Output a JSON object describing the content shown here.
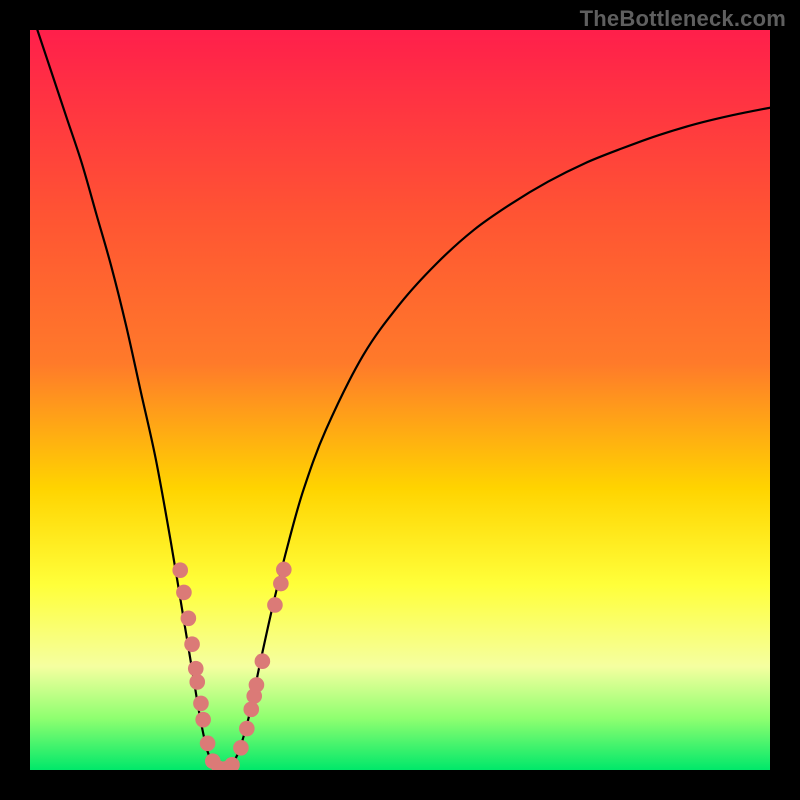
{
  "watermark": "TheBottleneck.com",
  "colors": {
    "gradient_top": "#ff1f4b",
    "gradient_mid1": "#ff7a2a",
    "gradient_mid2": "#ffd400",
    "gradient_yellow": "#ffff3a",
    "gradient_pale": "#f5ffa0",
    "gradient_green1": "#8fff70",
    "gradient_green2": "#00e86a",
    "curve": "#000000",
    "marker_fill": "#db7a77",
    "marker_stroke": "#b85a58"
  },
  "chart_data": {
    "type": "line",
    "title": "",
    "xlabel": "",
    "ylabel": "",
    "xlim": [
      0,
      100
    ],
    "ylim": [
      0,
      100
    ],
    "optimum_x": 26,
    "series": [
      {
        "name": "bottleneck-curve",
        "x": [
          1,
          3,
          5,
          7,
          9,
          11,
          13,
          15,
          17,
          19,
          21,
          22,
          23,
          24,
          25,
          26,
          27,
          28,
          29,
          30,
          31,
          33,
          35,
          37,
          40,
          45,
          50,
          55,
          60,
          65,
          70,
          75,
          80,
          85,
          90,
          95,
          100
        ],
        "y": [
          100,
          94,
          88,
          82,
          75,
          68,
          60,
          51,
          42,
          31,
          19,
          13,
          7,
          2.5,
          0.5,
          0,
          0.5,
          2,
          5,
          9,
          14,
          23,
          31,
          38,
          46,
          56,
          63,
          68.5,
          73,
          76.5,
          79.5,
          82,
          84,
          85.8,
          87.3,
          88.5,
          89.5
        ]
      }
    ],
    "markers": {
      "name": "sample-points",
      "points": [
        {
          "x": 20.3,
          "y": 27
        },
        {
          "x": 20.8,
          "y": 24
        },
        {
          "x": 21.4,
          "y": 20.5
        },
        {
          "x": 21.9,
          "y": 17
        },
        {
          "x": 22.4,
          "y": 13.7
        },
        {
          "x": 22.6,
          "y": 11.9
        },
        {
          "x": 23.1,
          "y": 9
        },
        {
          "x": 23.4,
          "y": 6.8
        },
        {
          "x": 24.0,
          "y": 3.6
        },
        {
          "x": 24.7,
          "y": 1.2
        },
        {
          "x": 25.6,
          "y": 0.2
        },
        {
          "x": 26.4,
          "y": 0.15
        },
        {
          "x": 27.3,
          "y": 0.7
        },
        {
          "x": 28.5,
          "y": 3.0
        },
        {
          "x": 29.3,
          "y": 5.6
        },
        {
          "x": 29.9,
          "y": 8.2
        },
        {
          "x": 30.3,
          "y": 10.0
        },
        {
          "x": 30.6,
          "y": 11.5
        },
        {
          "x": 31.4,
          "y": 14.7
        },
        {
          "x": 33.1,
          "y": 22.3
        },
        {
          "x": 33.9,
          "y": 25.2
        },
        {
          "x": 34.3,
          "y": 27.1
        }
      ]
    }
  }
}
